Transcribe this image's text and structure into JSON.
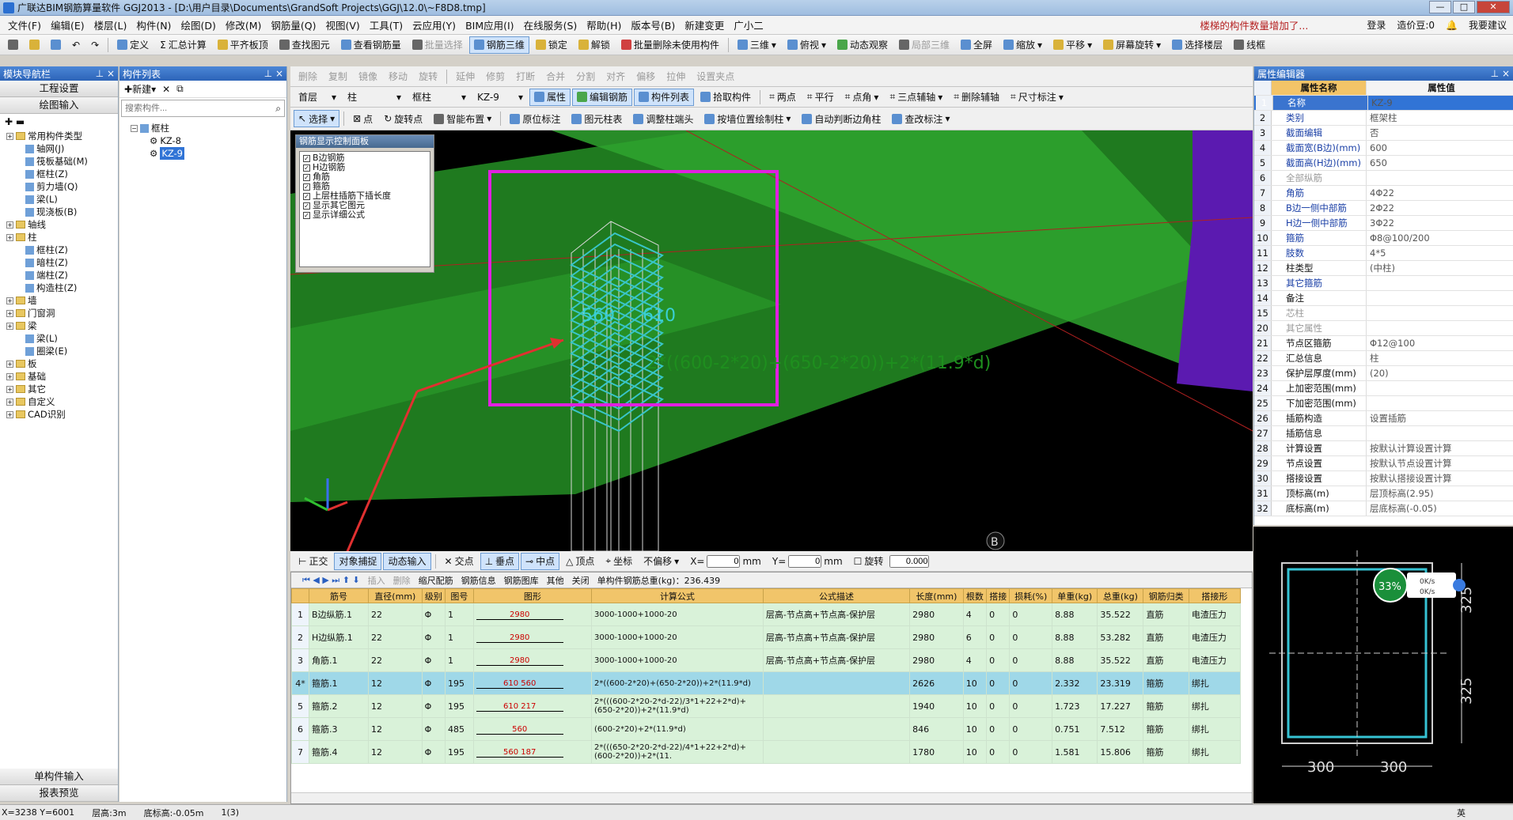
{
  "title": "广联达BIM钢筋算量软件 GGJ2013 - [D:\\用户目录\\Documents\\GrandSoft Projects\\GGJ\\12.0\\~F8D8.tmp]",
  "menu": [
    "文件(F)",
    "编辑(E)",
    "楼层(L)",
    "构件(N)",
    "绘图(D)",
    "修改(M)",
    "钢筋量(Q)",
    "视图(V)",
    "工具(T)",
    "云应用(Y)",
    "BIM应用(I)",
    "在线服务(S)",
    "帮助(H)",
    "版本号(B)",
    "新建变更",
    "广小二"
  ],
  "menu_right": {
    "hint": "楼梯的构件数量增加了...",
    "login": "登录",
    "beans": "造价豆:0",
    "suggest": "我要建议"
  },
  "toolbar1": [
    "定义",
    "汇总计算",
    "平齐板顶",
    "查找图元",
    "查看钢筋量",
    "批量选择",
    "钢筋三维",
    "锁定",
    "解锁",
    "批量删除未使用构件",
    "三维",
    "俯视",
    "动态观察",
    "局部三维",
    "全屏",
    "缩放",
    "平移",
    "屏幕旋转",
    "选择楼层",
    "线框"
  ],
  "toolbar2": [
    "删除",
    "复制",
    "镜像",
    "移动",
    "旋转",
    "延伸",
    "修剪",
    "打断",
    "合并",
    "分割",
    "对齐",
    "偏移",
    "拉伸",
    "设置夹点"
  ],
  "toolbar3": {
    "floor": "首层",
    "type": "柱",
    "sub": "框柱",
    "code": "KZ-9",
    "buttons": [
      "属性",
      "编辑钢筋",
      "构件列表",
      "拾取构件",
      "两点",
      "平行",
      "点角",
      "三点辅轴",
      "删除辅轴",
      "尺寸标注"
    ]
  },
  "toolbar4": [
    "选择",
    "点",
    "旋转点",
    "智能布置",
    "原位标注",
    "图元柱表",
    "调整柱端头",
    "按墙位置绘制柱",
    "自动判断边角柱",
    "查改标注"
  ],
  "leftnav": {
    "title": "模块导航栏",
    "top_buttons": [
      "工程设置",
      "绘图输入"
    ],
    "tree": [
      {
        "label": "常用构件类型",
        "level": 0
      },
      {
        "label": "轴网(J)",
        "level": 1
      },
      {
        "label": "筏板基础(M)",
        "level": 1
      },
      {
        "label": "框柱(Z)",
        "level": 1
      },
      {
        "label": "剪力墙(Q)",
        "level": 1
      },
      {
        "label": "梁(L)",
        "level": 1
      },
      {
        "label": "现浇板(B)",
        "level": 1
      },
      {
        "label": "轴线",
        "level": 0
      },
      {
        "label": "柱",
        "level": 0
      },
      {
        "label": "框柱(Z)",
        "level": 1
      },
      {
        "label": "暗柱(Z)",
        "level": 1
      },
      {
        "label": "端柱(Z)",
        "level": 1
      },
      {
        "label": "构造柱(Z)",
        "level": 1
      },
      {
        "label": "墙",
        "level": 0
      },
      {
        "label": "门窗洞",
        "level": 0
      },
      {
        "label": "梁",
        "level": 0
      },
      {
        "label": "梁(L)",
        "level": 1
      },
      {
        "label": "圈梁(E)",
        "level": 1
      },
      {
        "label": "板",
        "level": 0
      },
      {
        "label": "基础",
        "level": 0
      },
      {
        "label": "其它",
        "level": 0
      },
      {
        "label": "自定义",
        "level": 0
      },
      {
        "label": "CAD识别",
        "level": 0
      }
    ],
    "bottom_buttons": [
      "单构件输入",
      "报表预览"
    ]
  },
  "complist": {
    "title": "构件列表",
    "new": "新建",
    "search_placeholder": "搜索构件...",
    "root": "框柱",
    "items": [
      "KZ-8",
      "KZ-9"
    ]
  },
  "ctrlpanel": {
    "title": "钢筋显示控制面板",
    "items": [
      "B边钢筋",
      "H边钢筋",
      "角筋",
      "箍筋",
      "上层柱插筋下插长度",
      "显示其它图元",
      "显示详细公式"
    ]
  },
  "view3d": {
    "label1": "560",
    "label2": "610",
    "formula": "2*((600-2*20)+(650-2*20))+2*(11.9*d)",
    "axis_b": "B"
  },
  "snapbar": {
    "items": [
      "正交",
      "对象捕捉",
      "动态输入",
      "交点",
      "垂点",
      "中点",
      "顶点",
      "坐标"
    ],
    "offset": "不偏移",
    "x": "0",
    "y": "0",
    "unit": "mm",
    "rotate": "旋转",
    "rotate_val": "0.000"
  },
  "tablebar": {
    "items": [
      "插入",
      "删除",
      "缩尺配筋",
      "钢筋信息",
      "钢筋图库",
      "其他",
      "关闭"
    ],
    "total": "单构件钢筋总重(kg)：236.439"
  },
  "table": {
    "headers": [
      "筋号",
      "直径(mm)",
      "级别",
      "图号",
      "图形",
      "计算公式",
      "公式描述",
      "长度(mm)",
      "根数",
      "搭接",
      "损耗(%)",
      "单重(kg)",
      "总重(kg)",
      "钢筋归类",
      "搭接形"
    ],
    "rows": [
      {
        "n": "1",
        "c": [
          "B边纵筋.1",
          "22",
          "Φ",
          "1",
          "2980",
          "3000-1000+1000-20",
          "层高-节点高+节点高-保护层",
          "2980",
          "4",
          "0",
          "0",
          "8.88",
          "35.522",
          "直筋",
          "电渣压力"
        ]
      },
      {
        "n": "2",
        "c": [
          "H边纵筋.1",
          "22",
          "Φ",
          "1",
          "2980",
          "3000-1000+1000-20",
          "层高-节点高+节点高-保护层",
          "2980",
          "6",
          "0",
          "0",
          "8.88",
          "53.282",
          "直筋",
          "电渣压力"
        ]
      },
      {
        "n": "3",
        "c": [
          "角筋.1",
          "22",
          "Φ",
          "1",
          "2980",
          "3000-1000+1000-20",
          "层高-节点高+节点高-保护层",
          "2980",
          "4",
          "0",
          "0",
          "8.88",
          "35.522",
          "直筋",
          "电渣压力"
        ]
      },
      {
        "n": "4*",
        "c": [
          "箍筋.1",
          "12",
          "Φ",
          "195",
          "610 560",
          "2*((600-2*20)+(650-2*20))+2*(11.9*d)",
          "",
          "2626",
          "10",
          "0",
          "0",
          "2.332",
          "23.319",
          "箍筋",
          "绑扎"
        ]
      },
      {
        "n": "5",
        "c": [
          "箍筋.2",
          "12",
          "Φ",
          "195",
          "610 217",
          "2*(((600-2*20-2*d-22)/3*1+22+2*d)+(650-2*20))+2*(11.9*d)",
          "",
          "1940",
          "10",
          "0",
          "0",
          "1.723",
          "17.227",
          "箍筋",
          "绑扎"
        ]
      },
      {
        "n": "6",
        "c": [
          "箍筋.3",
          "12",
          "Φ",
          "485",
          "560",
          "(600-2*20)+2*(11.9*d)",
          "",
          "846",
          "10",
          "0",
          "0",
          "0.751",
          "7.512",
          "箍筋",
          "绑扎"
        ]
      },
      {
        "n": "7",
        "c": [
          "箍筋.4",
          "12",
          "Φ",
          "195",
          "560 187",
          "2*(((650-2*20-2*d-22)/4*1+22+2*d)+(600-2*20))+2*(11.",
          "",
          "1780",
          "10",
          "0",
          "0",
          "1.581",
          "15.806",
          "箍筋",
          "绑扎"
        ]
      }
    ]
  },
  "props": {
    "title": "属性编辑器",
    "col_name": "属性名称",
    "col_value": "属性值",
    "rows": [
      {
        "i": "1",
        "k": "名称",
        "v": "KZ-9",
        "blue": true,
        "sel": true
      },
      {
        "i": "2",
        "k": "类别",
        "v": "框架柱",
        "blue": true
      },
      {
        "i": "3",
        "k": "截面编辑",
        "v": "否",
        "blue": true
      },
      {
        "i": "4",
        "k": "截面宽(B边)(mm)",
        "v": "600",
        "blue": true
      },
      {
        "i": "5",
        "k": "截面高(H边)(mm)",
        "v": "650",
        "blue": true
      },
      {
        "i": "6",
        "k": "全部纵筋",
        "v": "",
        "grp": true
      },
      {
        "i": "7",
        "k": "角筋",
        "v": "4Φ22",
        "blue": true
      },
      {
        "i": "8",
        "k": "B边一侧中部筋",
        "v": "2Φ22",
        "blue": true
      },
      {
        "i": "9",
        "k": "H边一侧中部筋",
        "v": "3Φ22",
        "blue": true
      },
      {
        "i": "10",
        "k": "箍筋",
        "v": "Φ8@100/200",
        "blue": true
      },
      {
        "i": "11",
        "k": "肢数",
        "v": "4*5",
        "blue": true
      },
      {
        "i": "12",
        "k": "柱类型",
        "v": "(中柱)"
      },
      {
        "i": "13",
        "k": "其它箍筋",
        "v": "",
        "blue": true
      },
      {
        "i": "14",
        "k": "备注",
        "v": ""
      },
      {
        "i": "15",
        "k": "芯柱",
        "v": "",
        "grp": true
      },
      {
        "i": "20",
        "k": "其它属性",
        "v": "",
        "grp": true
      },
      {
        "i": "21",
        "k": "节点区箍筋",
        "v": "Φ12@100"
      },
      {
        "i": "22",
        "k": "汇总信息",
        "v": "柱"
      },
      {
        "i": "23",
        "k": "保护层厚度(mm)",
        "v": "(20)"
      },
      {
        "i": "24",
        "k": "上加密范围(mm)",
        "v": ""
      },
      {
        "i": "25",
        "k": "下加密范围(mm)",
        "v": ""
      },
      {
        "i": "26",
        "k": "插筋构造",
        "v": "设置插筋"
      },
      {
        "i": "27",
        "k": "插筋信息",
        "v": ""
      },
      {
        "i": "28",
        "k": "计算设置",
        "v": "按默认计算设置计算"
      },
      {
        "i": "29",
        "k": "节点设置",
        "v": "按默认节点设置计算"
      },
      {
        "i": "30",
        "k": "搭接设置",
        "v": "按默认搭接设置计算"
      },
      {
        "i": "31",
        "k": "顶标高(m)",
        "v": "层顶标高(2.95)"
      },
      {
        "i": "32",
        "k": "底标高(m)",
        "v": "层底标高(-0.05)"
      }
    ]
  },
  "section": {
    "dim_h1": "325",
    "dim_h2": "325",
    "dim_w1": "300",
    "dim_w2": "300",
    "badge": "33%",
    "speed1": "0K/s",
    "speed2": "0K/s"
  },
  "status": {
    "coords": "X=3238 Y=6001",
    "floor_h": "层高:3m",
    "base": "底标高:-0.05m",
    "count": "1(3)"
  },
  "tray": [
    "英"
  ]
}
